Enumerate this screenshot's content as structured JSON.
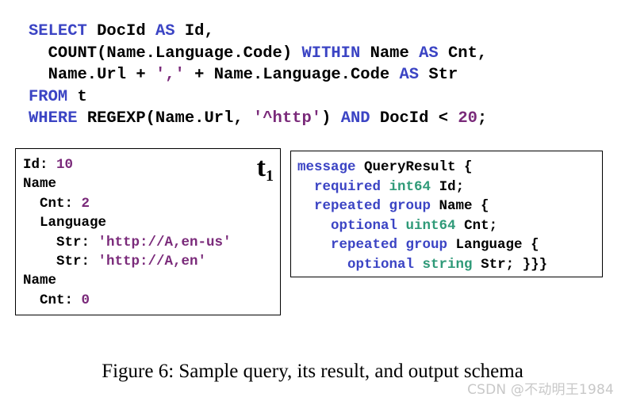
{
  "query": {
    "line1": {
      "kw1": "SELECT",
      "t1": " DocId ",
      "kw2": "AS",
      "t2": " Id,"
    },
    "line2": {
      "t1": "  COUNT(Name.Language.Code) ",
      "kw1": "WITHIN",
      "t2": " Name ",
      "kw2": "AS",
      "t3": " Cnt,"
    },
    "line3": {
      "t1": "  Name.Url + ",
      "s1": "','",
      "t2": " + Name.Language.Code ",
      "kw1": "AS",
      "t3": " Str"
    },
    "line4": {
      "kw1": "FROM",
      "t1": " t"
    },
    "line5": {
      "kw1": "WHERE",
      "t1": " REGEXP(Name.Url, ",
      "s1": "'^http'",
      "t2": ") ",
      "kw2": "AND",
      "t3": " DocId < ",
      "n1": "20",
      "t4": ";"
    }
  },
  "result": {
    "label_main": "t",
    "label_sub": "1",
    "lines": {
      "id_key": "Id: ",
      "id_val": "10",
      "name1": "Name",
      "cnt1_key": "  Cnt: ",
      "cnt1_val": "2",
      "language": "  Language",
      "str1_key": "    Str: ",
      "str1_val": "'http://A,en-us'",
      "str2_key": "    Str: ",
      "str2_val": "'http://A,en'",
      "name2": "Name",
      "cnt2_key": "  Cnt: ",
      "cnt2_val": "0"
    }
  },
  "schema": {
    "line1": {
      "kw1": "message",
      "t1": " QueryResult {"
    },
    "line2": {
      "ind": "  ",
      "kw1": "required",
      "sp": " ",
      "ty1": "int64",
      "t1": " Id;"
    },
    "line3": {
      "ind": "  ",
      "kw1": "repeated group",
      "t1": " Name {"
    },
    "line4": {
      "ind": "    ",
      "kw1": "optional",
      "sp": " ",
      "ty1": "uint64",
      "t1": " Cnt;"
    },
    "line5": {
      "ind": "    ",
      "kw1": "repeated group",
      "t1": " Language {"
    },
    "line6": {
      "ind": "      ",
      "kw1": "optional",
      "sp": " ",
      "ty1": "string",
      "t1": " Str; }}}"
    }
  },
  "caption": "Figure 6: Sample query, its result, and output schema",
  "watermark": "CSDN @不动明王1984",
  "colors": {
    "keyword": "#3b44c4",
    "type": "#2f9a78",
    "literal": "#7a2a7a"
  }
}
